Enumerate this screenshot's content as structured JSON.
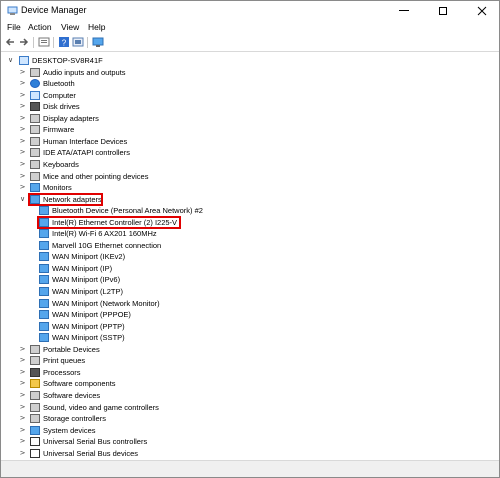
{
  "window": {
    "title": "Device Manager"
  },
  "menu": [
    "File",
    "Action",
    "View",
    "Help"
  ],
  "toolbar": {
    "buttons": [
      "back-icon",
      "forward-icon",
      "properties-icon",
      "help-icon",
      "scan-icon",
      "monitor-icon"
    ]
  },
  "tree": {
    "root": "DESKTOP-SV8R41F",
    "categories": [
      {
        "label": "Audio inputs and outputs",
        "icon": "speaker-icon"
      },
      {
        "label": "Bluetooth",
        "icon": "bluetooth-icon"
      },
      {
        "label": "Computer",
        "icon": "computer-icon"
      },
      {
        "label": "Disk drives",
        "icon": "disk-icon"
      },
      {
        "label": "Display adapters",
        "icon": "display-adapter-icon"
      },
      {
        "label": "Firmware",
        "icon": "firmware-icon"
      },
      {
        "label": "Human Interface Devices",
        "icon": "hid-icon"
      },
      {
        "label": "IDE ATA/ATAPI controllers",
        "icon": "ide-icon"
      },
      {
        "label": "Keyboards",
        "icon": "keyboard-icon"
      },
      {
        "label": "Mice and other pointing devices",
        "icon": "mouse-icon"
      },
      {
        "label": "Monitors",
        "icon": "monitor-icon"
      },
      {
        "label": "Network adapters",
        "icon": "network-icon",
        "expanded": true
      }
    ],
    "network_children": [
      "Bluetooth Device (Personal Area Network) #2",
      "Intel(R) Ethernet Controller (2) I225-V",
      "Intel(R) Wi-Fi 6 AX201 160MHz",
      "Marvell 10G Ethernet connection",
      "WAN Miniport (IKEv2)",
      "WAN Miniport (IP)",
      "WAN Miniport (IPv6)",
      "WAN Miniport (L2TP)",
      "WAN Miniport (Network Monitor)",
      "WAN Miniport (PPPOE)",
      "WAN Miniport (PPTP)",
      "WAN Miniport (SSTP)"
    ],
    "categories_after": [
      {
        "label": "Portable Devices",
        "icon": "portable-icon"
      },
      {
        "label": "Print queues",
        "icon": "printer-icon"
      },
      {
        "label": "Processors",
        "icon": "processor-icon"
      },
      {
        "label": "Software components",
        "icon": "software-component-icon"
      },
      {
        "label": "Software devices",
        "icon": "software-device-icon"
      },
      {
        "label": "Sound, video and game controllers",
        "icon": "sound-icon"
      },
      {
        "label": "Storage controllers",
        "icon": "storage-icon"
      },
      {
        "label": "System devices",
        "icon": "system-icon"
      },
      {
        "label": "Universal Serial Bus controllers",
        "icon": "usb-icon"
      },
      {
        "label": "Universal Serial Bus devices",
        "icon": "usb-icon"
      }
    ]
  },
  "colors": {
    "highlight": "#e00000",
    "network_icon": "#55a6ec"
  }
}
